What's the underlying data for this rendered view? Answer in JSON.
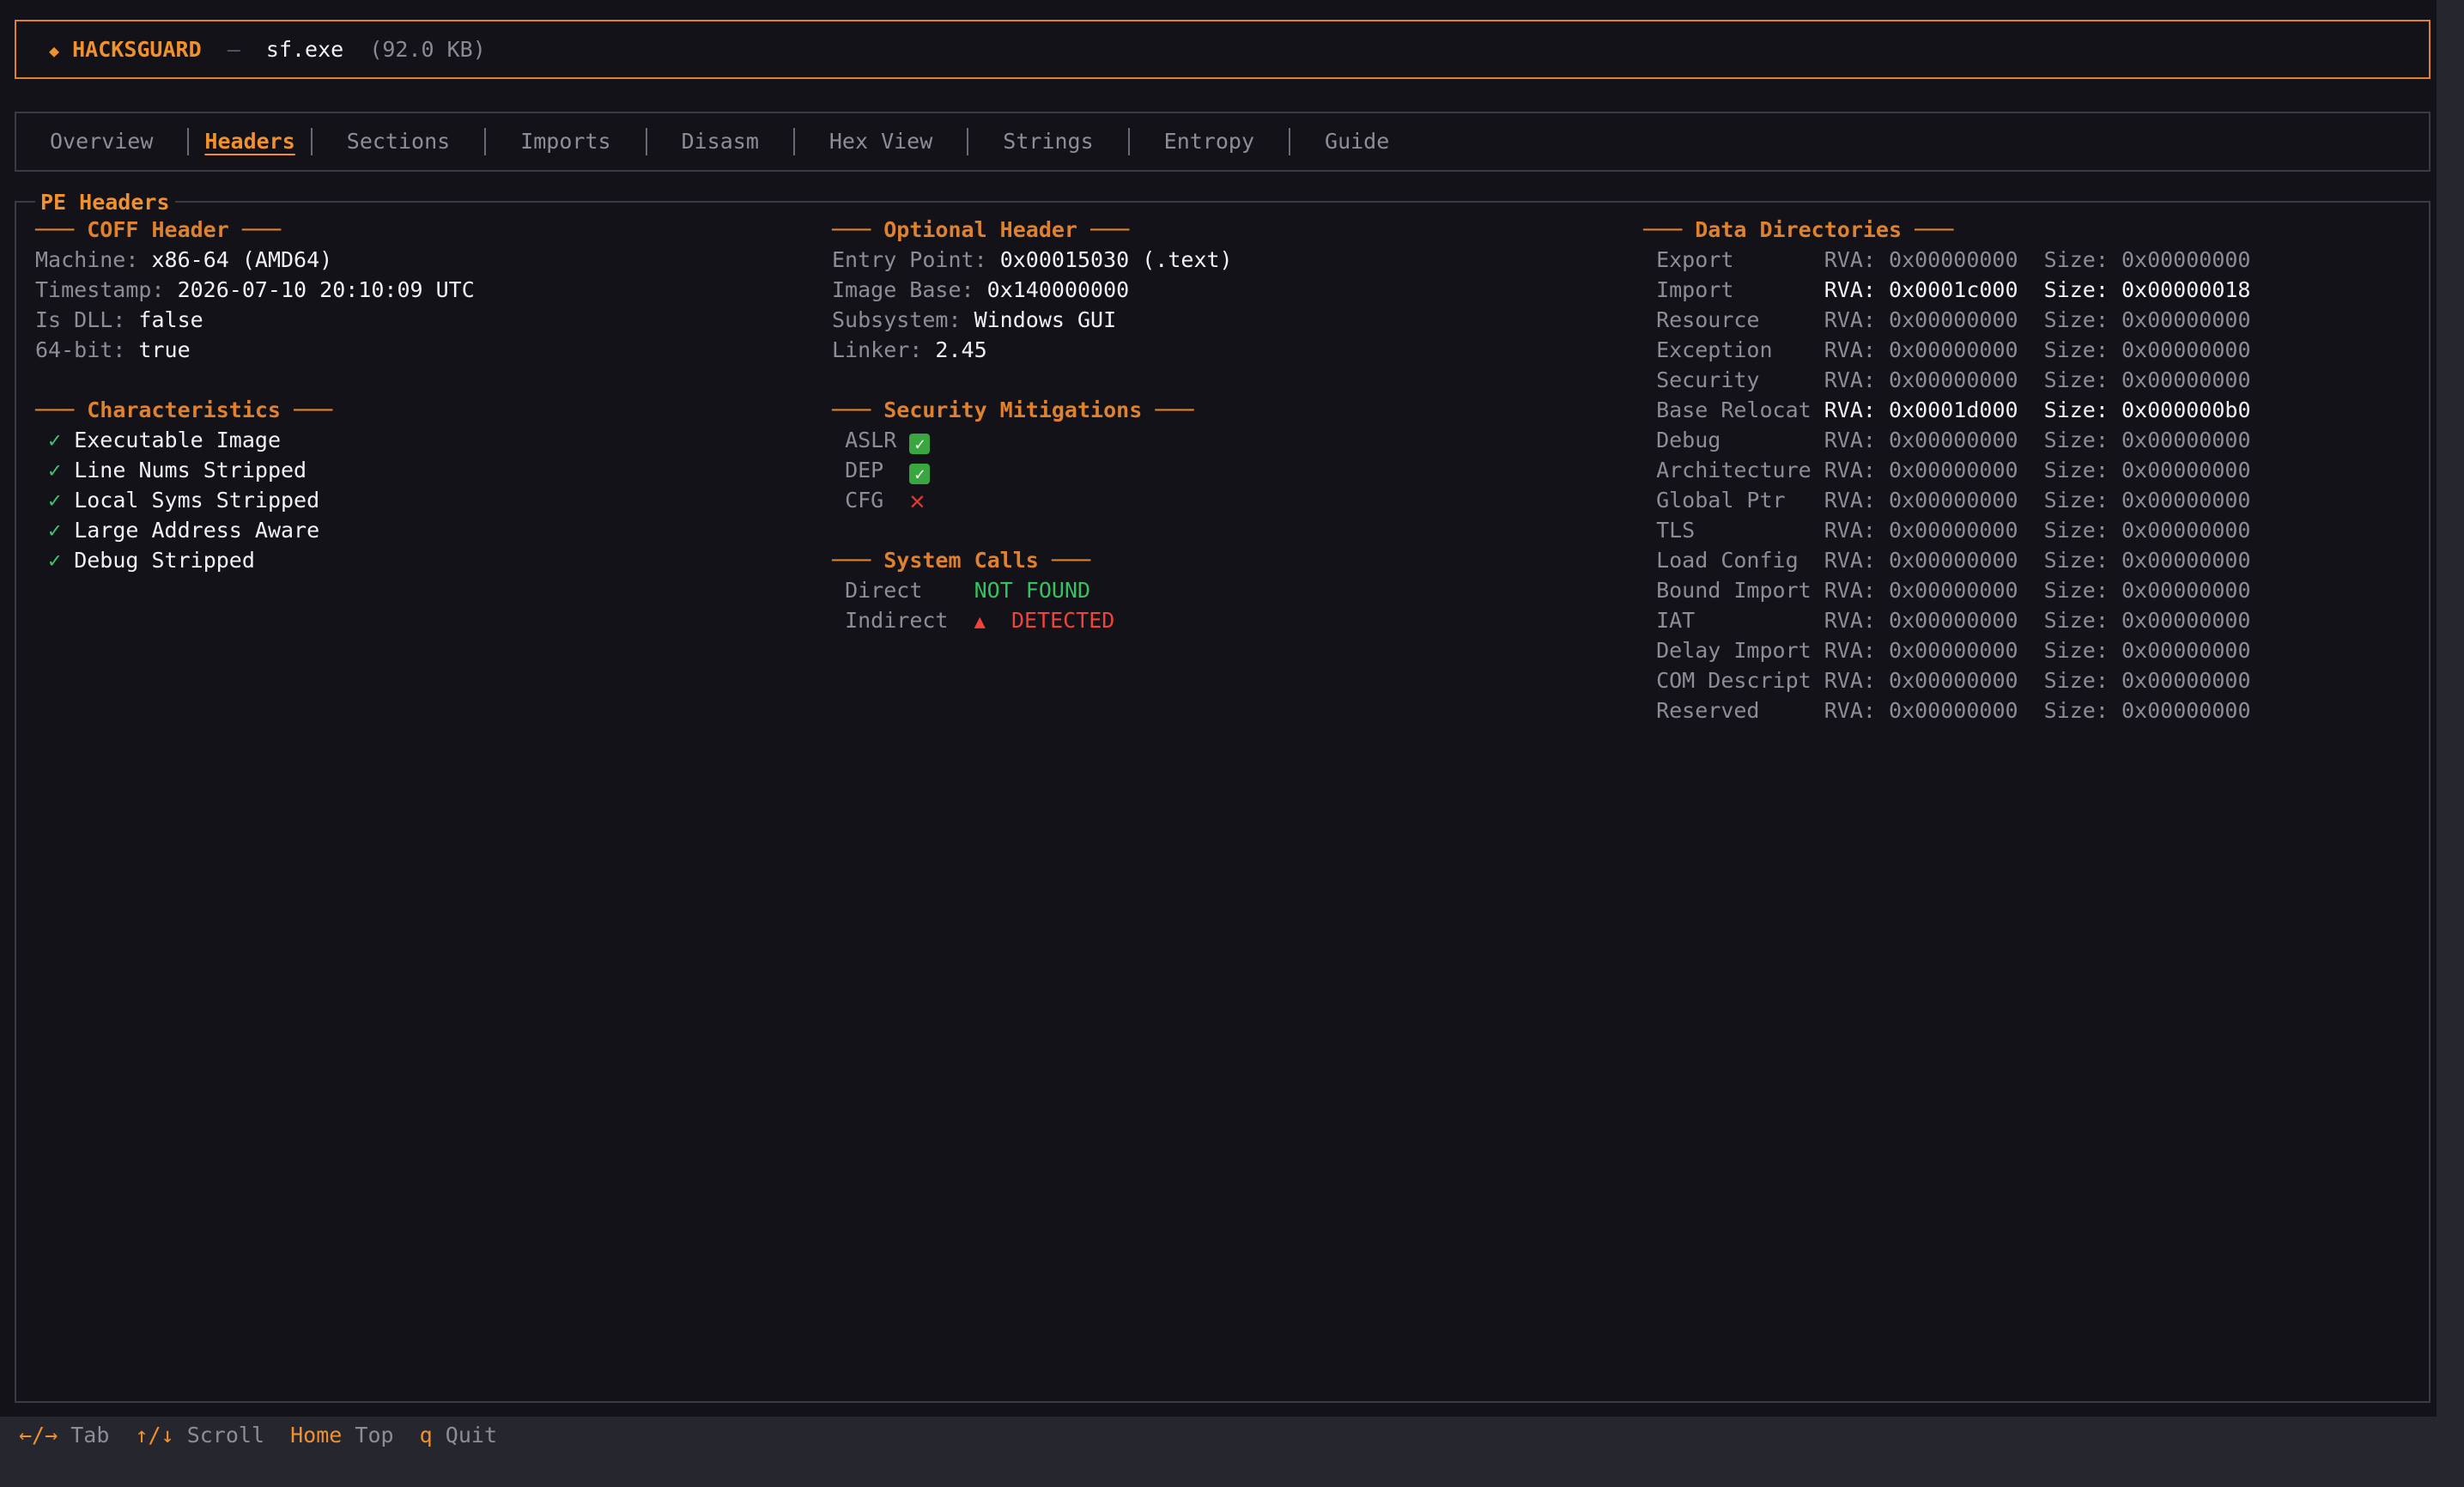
{
  "app": {
    "diamond": "◆",
    "name": "HACKSGUARD",
    "separator": "—",
    "file_name": "sf.exe",
    "file_size": "(92.0 KB)"
  },
  "tabs": [
    {
      "label": "Overview",
      "active": false
    },
    {
      "label": "Headers",
      "active": true
    },
    {
      "label": "Sections",
      "active": false
    },
    {
      "label": "Imports",
      "active": false
    },
    {
      "label": "Disasm",
      "active": false
    },
    {
      "label": "Hex View",
      "active": false
    },
    {
      "label": "Strings",
      "active": false
    },
    {
      "label": "Entropy",
      "active": false
    },
    {
      "label": "Guide",
      "active": false
    }
  ],
  "panel_title": "PE Headers",
  "coff": {
    "title": "COFF Header",
    "rows": [
      {
        "key": "Machine:",
        "value": "x86-64 (AMD64)"
      },
      {
        "key": "Timestamp:",
        "value": "2026-07-10 20:10:09 UTC"
      },
      {
        "key": "Is DLL:",
        "value": "false"
      },
      {
        "key": "64-bit:",
        "value": "true"
      }
    ]
  },
  "characteristics": {
    "title": "Characteristics",
    "check_glyph": "✓",
    "items": [
      "Executable Image",
      "Line Nums Stripped",
      "Local Syms Stripped",
      "Large Address Aware",
      "Debug Stripped"
    ]
  },
  "optional": {
    "title": "Optional Header",
    "rows": [
      {
        "key": "Entry Point:",
        "value": "0x00015030 (.text)"
      },
      {
        "key": "Image Base:",
        "value": "0x140000000"
      },
      {
        "key": "Subsystem:",
        "value": "Windows GUI"
      },
      {
        "key": "Linker:",
        "value": "2.45"
      }
    ]
  },
  "mitigations": {
    "title": "Security Mitigations",
    "items": [
      {
        "name": "ASLR",
        "enabled": true,
        "glyph": "✓"
      },
      {
        "name": "DEP",
        "enabled": true,
        "glyph": "✓"
      },
      {
        "name": "CFG",
        "enabled": false,
        "glyph": "✕"
      }
    ]
  },
  "syscalls": {
    "title": "System Calls",
    "direct_label": "Direct",
    "direct_value": "NOT FOUND",
    "indirect_label": "Indirect",
    "indirect_glyph": "▲",
    "indirect_value": "DETECTED"
  },
  "data_dirs": {
    "title": "Data Directories",
    "rva_label": "RVA:",
    "size_label": "Size:",
    "rows": [
      {
        "name": "Export",
        "rva": "0x00000000",
        "size": "0x00000000",
        "present": false
      },
      {
        "name": "Import",
        "rva": "0x0001c000",
        "size": "0x00000018",
        "present": true
      },
      {
        "name": "Resource",
        "rva": "0x00000000",
        "size": "0x00000000",
        "present": false
      },
      {
        "name": "Exception",
        "rva": "0x00000000",
        "size": "0x00000000",
        "present": false
      },
      {
        "name": "Security",
        "rva": "0x00000000",
        "size": "0x00000000",
        "present": false
      },
      {
        "name": "Base Relocat",
        "rva": "0x0001d000",
        "size": "0x000000b0",
        "present": true
      },
      {
        "name": "Debug",
        "rva": "0x00000000",
        "size": "0x00000000",
        "present": false
      },
      {
        "name": "Architecture",
        "rva": "0x00000000",
        "size": "0x00000000",
        "present": false
      },
      {
        "name": "Global Ptr",
        "rva": "0x00000000",
        "size": "0x00000000",
        "present": false
      },
      {
        "name": "TLS",
        "rva": "0x00000000",
        "size": "0x00000000",
        "present": false
      },
      {
        "name": "Load Config",
        "rva": "0x00000000",
        "size": "0x00000000",
        "present": false
      },
      {
        "name": "Bound Import",
        "rva": "0x00000000",
        "size": "0x00000000",
        "present": false
      },
      {
        "name": "IAT",
        "rva": "0x00000000",
        "size": "0x00000000",
        "present": false
      },
      {
        "name": "Delay Import",
        "rva": "0x00000000",
        "size": "0x00000000",
        "present": false
      },
      {
        "name": "COM Descript",
        "rva": "0x00000000",
        "size": "0x00000000",
        "present": false
      },
      {
        "name": "Reserved",
        "rva": "0x00000000",
        "size": "0x00000000",
        "present": false
      }
    ]
  },
  "status_bar": [
    {
      "key": "←/→",
      "desc": "Tab"
    },
    {
      "key": "↑/↓",
      "desc": "Scroll"
    },
    {
      "key": "Home",
      "desc": "Top"
    },
    {
      "key": "q",
      "desc": "Quit"
    }
  ],
  "colors": {
    "accent": "#f0902e",
    "background": "#121218",
    "ok": "#35c35f",
    "danger": "#f0433a"
  }
}
